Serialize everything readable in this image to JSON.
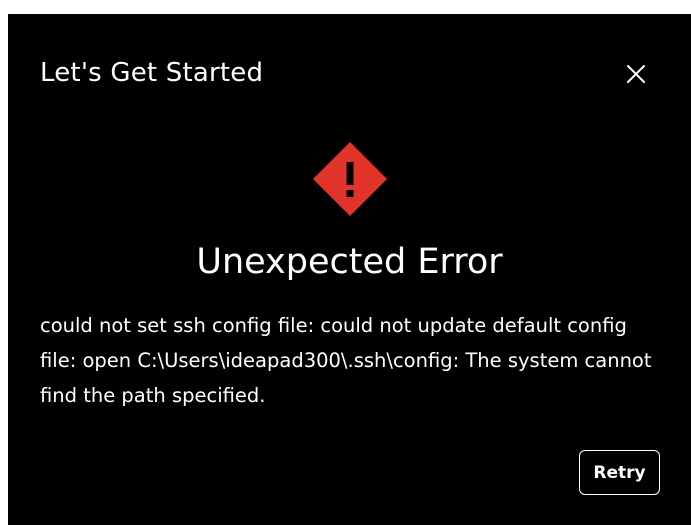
{
  "dialog": {
    "title": "Let's Get Started",
    "close_icon": "close-icon",
    "warning_icon": "warning-diamond-icon",
    "heading": "Unexpected Error",
    "message": "could not set ssh config file: could not update default config file: open C:\\Users\\ideapad300\\.ssh\\config: The system cannot find the path specified.",
    "retry_label": "Retry"
  },
  "colors": {
    "background": "#000000",
    "text": "#ffffff",
    "warning": "#e2342a"
  }
}
